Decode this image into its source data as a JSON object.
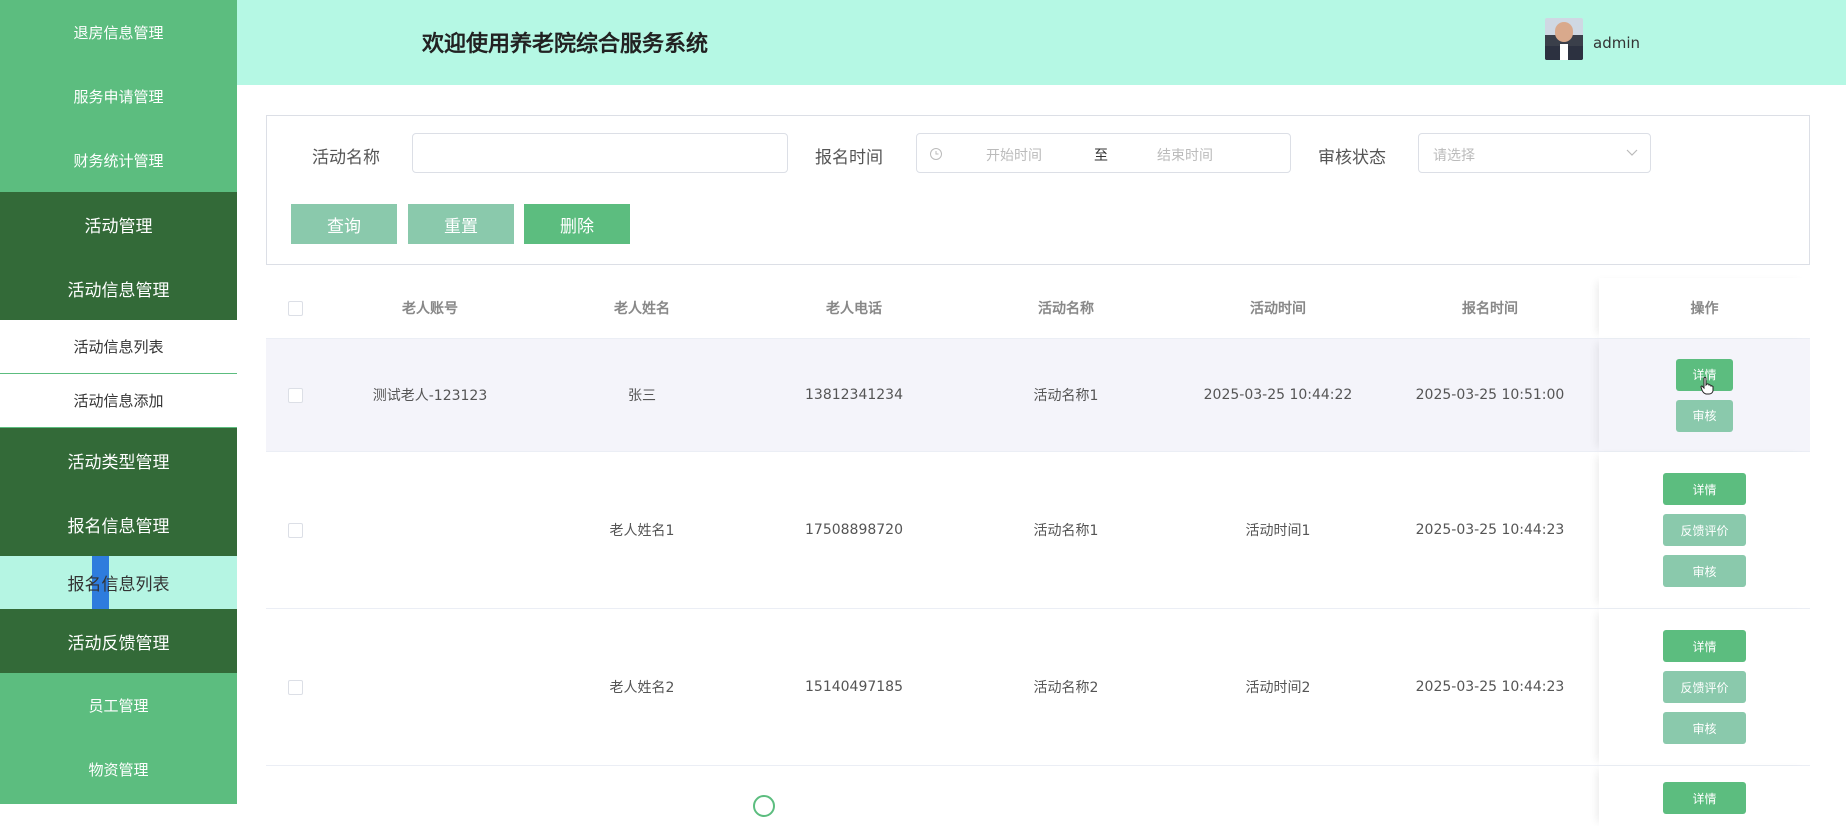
{
  "sidebar": {
    "items": [
      {
        "label": "退房信息管理"
      },
      {
        "label": "服务申请管理"
      },
      {
        "label": "财务统计管理"
      },
      {
        "label": "活动管理"
      },
      {
        "label": "活动信息管理"
      },
      {
        "label": "活动信息列表"
      },
      {
        "label": "活动信息添加"
      },
      {
        "label": "活动类型管理"
      },
      {
        "label": "报名信息管理"
      },
      {
        "label": "报名信息列表"
      },
      {
        "label": "活动反馈管理"
      },
      {
        "label": "员工管理"
      },
      {
        "label": "物资管理"
      }
    ]
  },
  "header": {
    "title": "欢迎使用养老院综合服务系统",
    "user": "admin"
  },
  "search": {
    "activity_name_label": "活动名称",
    "activity_name_value": "",
    "signup_time_label": "报名时间",
    "start_placeholder": "开始时间",
    "range_sep": "至",
    "end_placeholder": "结束时间",
    "status_label": "审核状态",
    "status_placeholder": "请选择",
    "query_btn": "查询",
    "reset_btn": "重置",
    "delete_btn": "删除"
  },
  "table": {
    "headers": [
      "老人账号",
      "老人姓名",
      "老人电话",
      "活动名称",
      "活动时间",
      "报名时间",
      "操作"
    ],
    "rows": [
      {
        "account": "测试老人-123123",
        "name": "张三",
        "phone": "13812341234",
        "activity": "活动名称1",
        "act_time": "2025-03-25 10:44:22",
        "signup_time": "2025-03-25 10:51:00",
        "ops": [
          "详情",
          "审核"
        ]
      },
      {
        "account": "",
        "name": "老人姓名1",
        "phone": "17508898720",
        "activity": "活动名称1",
        "act_time": "活动时间1",
        "signup_time": "2025-03-25 10:44:23",
        "ops": [
          "详情",
          "反馈评价",
          "审核"
        ]
      },
      {
        "account": "",
        "name": "老人姓名2",
        "phone": "15140497185",
        "activity": "活动名称2",
        "act_time": "活动时间2",
        "signup_time": "2025-03-25 10:44:23",
        "ops": [
          "详情",
          "反馈评价",
          "审核"
        ]
      },
      {
        "ops": [
          "详情"
        ]
      }
    ]
  },
  "colors": {
    "brand_green": "#5cbd7f",
    "dark_green": "#336a38",
    "header_bg": "#b5f8e4",
    "light_green_btn": "#8ac9ac"
  }
}
